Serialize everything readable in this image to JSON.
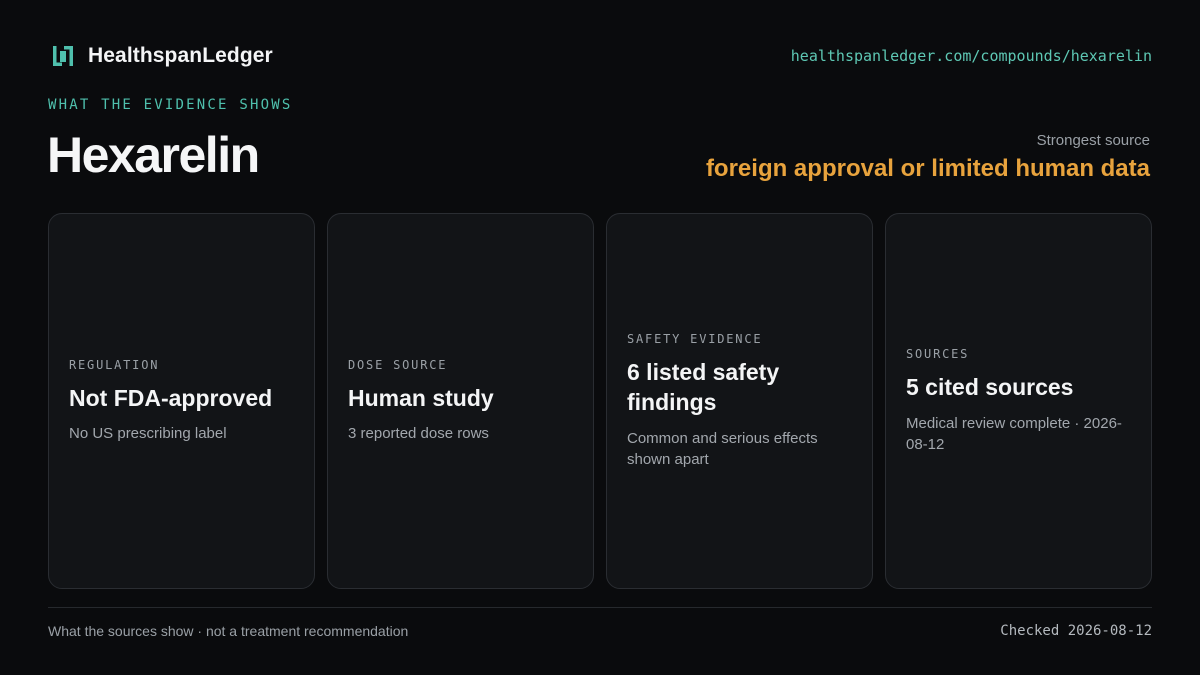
{
  "header": {
    "brand_icon": "ledger-logo-icon",
    "brand_name": "HealthspanLedger",
    "url": "healthspanledger.com/compounds/hexarelin"
  },
  "hero": {
    "eyebrow": "WHAT THE EVIDENCE SHOWS",
    "title": "Hexarelin",
    "strongest_source_label": "Strongest source",
    "strongest_source_value": "foreign approval or limited human data"
  },
  "cards": [
    {
      "label": "REGULATION",
      "value": "Not FDA-approved",
      "sub": "No US prescribing label"
    },
    {
      "label": "DOSE SOURCE",
      "value": "Human study",
      "sub": "3 reported dose rows"
    },
    {
      "label": "SAFETY EVIDENCE",
      "value": "6 listed safety findings",
      "sub": "Common and serious effects shown apart"
    },
    {
      "label": "SOURCES",
      "value": "5 cited sources",
      "sub": "Medical review complete · 2026-08-12"
    }
  ],
  "footer": {
    "disclaimer": "What the sources show · not a treatment recommendation",
    "checked": "Checked 2026-08-12"
  },
  "colors": {
    "background": "#0a0b0d",
    "accent_teal": "#4fc0ad",
    "accent_amber": "#e8a33d",
    "card_background": "#121417"
  }
}
